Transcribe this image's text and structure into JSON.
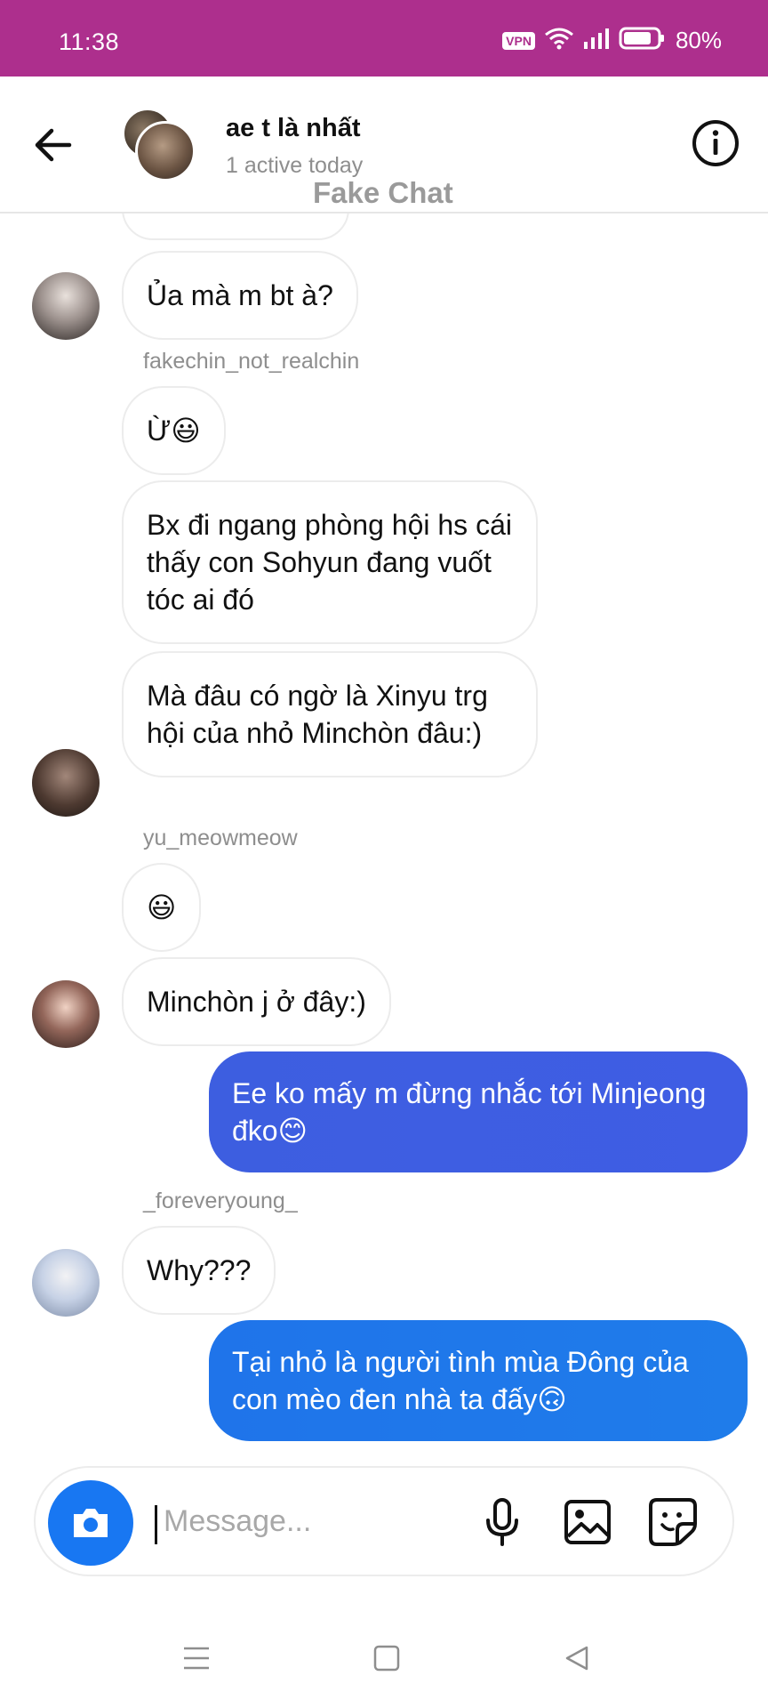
{
  "status_bar": {
    "time": "11:38",
    "vpn": "VPN",
    "battery": "80%"
  },
  "header": {
    "title": "ae t là nhất",
    "status": "1 active today",
    "watermark": "Fake Chat"
  },
  "messages": [
    {
      "type": "in",
      "text": "Ủa mà m bt à?"
    },
    {
      "type": "name",
      "text": "fakechin_not_realchin"
    },
    {
      "type": "in",
      "text": "Ừ😃"
    },
    {
      "type": "in",
      "text": "Bx đi ngang phòng hội hs cái thấy con Sohyun đang vuốt tóc ai đó"
    },
    {
      "type": "in",
      "text": "Mà đâu có ngờ là Xinyu trg hội của nhỏ Minchòn đâu:)"
    },
    {
      "type": "name",
      "text": "yu_meowmeow"
    },
    {
      "type": "in",
      "text": "😃"
    },
    {
      "type": "in",
      "text": "Minchòn j ở đây:)"
    },
    {
      "type": "out",
      "text": "Ee ko mấy m đừng nhắc tới Minjeong đko😊"
    },
    {
      "type": "name",
      "text": "_foreveryoung_"
    },
    {
      "type": "in",
      "text": "Why???"
    },
    {
      "type": "out",
      "text": "Tại nhỏ là người tình mùa Đông của con mèo đen nhà ta đấy🙃"
    }
  ],
  "composer": {
    "placeholder": "Message..."
  },
  "icons": {
    "back": "arrow-left-icon",
    "info": "info-icon",
    "camera": "camera-icon",
    "mic": "microphone-icon",
    "gallery": "image-icon",
    "sticker": "sticker-icon"
  },
  "colors": {
    "status_bar": "#ad2f8d",
    "outgoing_bubble_1": "#3d5ee0",
    "outgoing_bubble_2": "#1f78ea",
    "camera_button": "#1877f2"
  }
}
